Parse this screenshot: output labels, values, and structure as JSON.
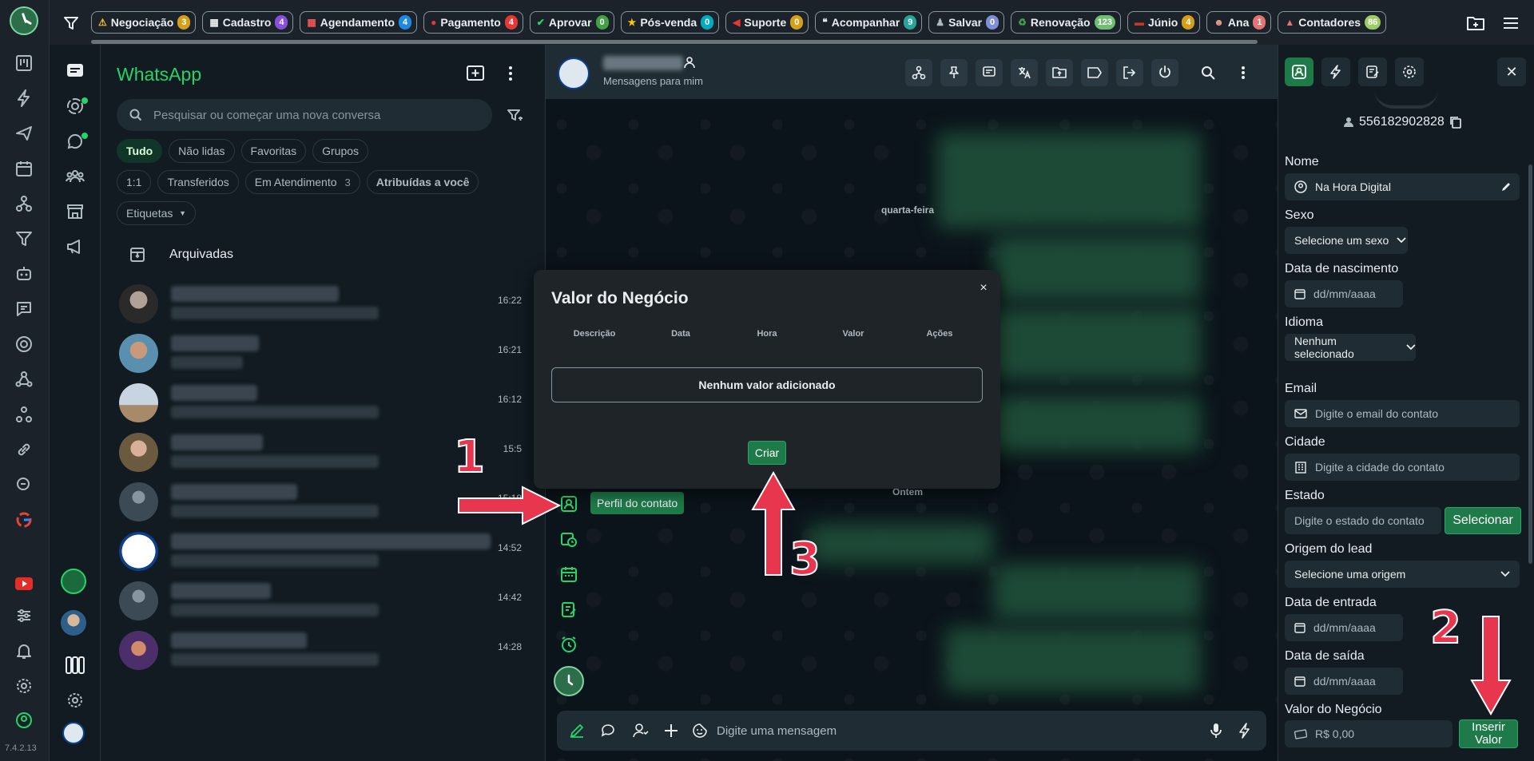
{
  "rail": {
    "version": "7.4.2.13"
  },
  "tagbar": {
    "tags": [
      {
        "label": "Negociação",
        "count": "3",
        "icon": "⚠",
        "icon_color": "#f5c518",
        "badge": "#d4a017"
      },
      {
        "label": "Cadastro",
        "count": "4",
        "icon": "▦",
        "icon_color": "#e9edef",
        "badge": "#8a4fd8"
      },
      {
        "label": "Agendamento",
        "count": "4",
        "icon": "▦",
        "icon_color": "#e55",
        "badge": "#1e88e5"
      },
      {
        "label": "Pagamento",
        "count": "4",
        "icon": "●",
        "icon_color": "#e53935",
        "badge": "#e53935"
      },
      {
        "label": "Aprovar",
        "count": "0",
        "icon": "✔",
        "icon_color": "#25d366",
        "badge": "#43a047"
      },
      {
        "label": "Pós-venda",
        "count": "0",
        "icon": "★",
        "icon_color": "#f5c518",
        "badge": "#00acc1"
      },
      {
        "label": "Suporte",
        "count": "0",
        "icon": "◀",
        "icon_color": "#e53935",
        "badge": "#d4a017"
      },
      {
        "label": "Acompanhar",
        "count": "9",
        "icon": "❝",
        "icon_color": "#e9edef",
        "badge": "#26a69a"
      },
      {
        "label": "Salvar",
        "count": "0",
        "icon": "♟",
        "icon_color": "#aebac1",
        "badge": "#7e8fd8"
      },
      {
        "label": "Renovação",
        "count": "123",
        "icon": "♻",
        "icon_color": "#43a047",
        "badge": "#6fbf73"
      },
      {
        "label": "Júnio",
        "count": "4",
        "icon": "▬",
        "icon_color": "#c0392b",
        "badge": "#d4a017"
      },
      {
        "label": "Ana",
        "count": "1",
        "icon": "☻",
        "icon_color": "#f0a090",
        "badge": "#e57373"
      },
      {
        "label": "Contadores",
        "count": "86",
        "icon": "▲",
        "icon_color": "#e57373",
        "badge": "#9ccc65"
      }
    ]
  },
  "listpanel": {
    "title": "WhatsApp",
    "search_placeholder": "Pesquisar ou começar uma nova conversa",
    "chips_row1": [
      "Tudo",
      "Não lidas",
      "Favoritas",
      "Grupos"
    ],
    "chips_row2": [
      {
        "label": "1:1",
        "n": ""
      },
      {
        "label": "Transferidos",
        "n": ""
      },
      {
        "label": "Em Atendimento",
        "n": "3"
      },
      {
        "label": "Atribuídas a você",
        "n": ""
      }
    ],
    "etiquetas": "Etiquetas",
    "archived": "Arquivadas",
    "chats": [
      {
        "time": "16:22"
      },
      {
        "time": "16:21"
      },
      {
        "time": "16:12"
      },
      {
        "time": "15:5"
      },
      {
        "time": "15:18"
      },
      {
        "time": "14:52"
      },
      {
        "time": "14:42"
      },
      {
        "time": "14:28"
      }
    ]
  },
  "chat": {
    "subtitle": "Mensagens para mim",
    "day_label_1": "quarta-feira",
    "day_label_2": "Ontem",
    "tooltip": "Perfil do contato",
    "composer_placeholder": "Digite uma mensagem"
  },
  "modal": {
    "title": "Valor do Negócio",
    "columns": [
      "Descrição",
      "Data",
      "Hora",
      "Valor",
      "Ações"
    ],
    "empty": "Nenhum valor adicionado",
    "create": "Criar",
    "close": "×"
  },
  "profile": {
    "phone": "556182902828",
    "nome_label": "Nome",
    "nome_value": "Na Hora Digital",
    "sexo_label": "Sexo",
    "sexo_value": "Selecione um sexo",
    "nasc_label": "Data de nascimento",
    "date_placeholder": "dd/mm/aaaa",
    "idioma_label": "Idioma",
    "idioma_value": "Nenhum selecionado",
    "email_label": "Email",
    "email_placeholder": "Digite o email do contato",
    "cidade_label": "Cidade",
    "cidade_placeholder": "Digite a cidade do contato",
    "estado_label": "Estado",
    "estado_placeholder": "Digite o estado do contato",
    "selecionar": "Selecionar",
    "origem_label": "Origem do lead",
    "origem_value": "Selecione uma origem",
    "entrada_label": "Data de entrada",
    "saida_label": "Data de saída",
    "valor_label": "Valor do Negócio",
    "valor_value": "R$ 0,00",
    "inserir": "Inserir Valor"
  },
  "annotations": {
    "n1": "1",
    "n2": "2",
    "n3": "3"
  },
  "colors": {
    "accent": "#25d366",
    "button_green": "#1f7a4a",
    "arrow_red": "#e8364f"
  }
}
